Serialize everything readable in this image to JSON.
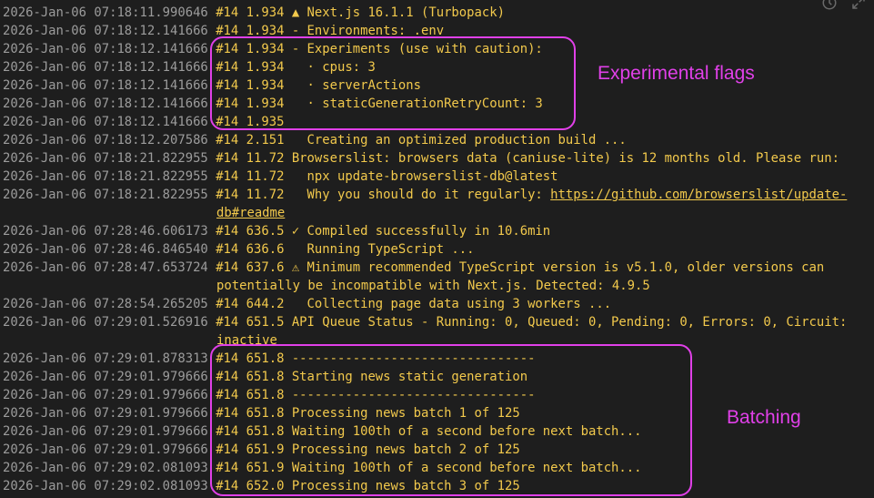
{
  "log_lines": [
    {
      "ts": "2026-Jan-06 07:18:11.990646",
      "msg": "#14 1.934 ▲ Next.js 16.1.1 (Turbopack)"
    },
    {
      "ts": "2026-Jan-06 07:18:12.141666",
      "msg": "#14 1.934 - Environments: .env"
    },
    {
      "ts": "2026-Jan-06 07:18:12.141666",
      "msg": "#14 1.934 - Experiments (use with caution):"
    },
    {
      "ts": "2026-Jan-06 07:18:12.141666",
      "msg": "#14 1.934   · cpus: 3"
    },
    {
      "ts": "2026-Jan-06 07:18:12.141666",
      "msg": "#14 1.934   · serverActions"
    },
    {
      "ts": "2026-Jan-06 07:18:12.141666",
      "msg": "#14 1.934   · staticGenerationRetryCount: 3"
    },
    {
      "ts": "2026-Jan-06 07:18:12.141666",
      "msg": "#14 1.935"
    },
    {
      "ts": "2026-Jan-06 07:18:12.207586",
      "msg": "#14 2.151   Creating an optimized production build ..."
    },
    {
      "ts": "2026-Jan-06 07:18:21.822955",
      "msg": "#14 11.72 Browserslist: browsers data (caniuse-lite) is 12 months old. Please run:"
    },
    {
      "ts": "2026-Jan-06 07:18:21.822955",
      "msg": "#14 11.72   npx update-browserslist-db@latest"
    },
    {
      "ts": "2026-Jan-06 07:18:21.822955",
      "msg": "#14 11.72   Why you should do it regularly: ",
      "link": "https://github.com/browserslist/update-"
    },
    {
      "ts": "",
      "msg": "",
      "link": "db#readme",
      "cont": true
    },
    {
      "ts": "2026-Jan-06 07:28:46.606173",
      "msg": "#14 636.5 ✓ Compiled successfully in 10.6min"
    },
    {
      "ts": "2026-Jan-06 07:28:46.846540",
      "msg": "#14 636.6   Running TypeScript ..."
    },
    {
      "ts": "2026-Jan-06 07:28:47.653724",
      "msg": "#14 637.6 ⚠ Minimum recommended TypeScript version is v5.1.0, older versions can"
    },
    {
      "ts": "",
      "msg": "potentially be incompatible with Next.js. Detected: 4.9.5",
      "cont": true
    },
    {
      "ts": "2026-Jan-06 07:28:54.265205",
      "msg": "#14 644.2   Collecting page data using 3 workers ..."
    },
    {
      "ts": "2026-Jan-06 07:29:01.526916",
      "msg": "#14 651.5 API Queue Status - Running: 0, Queued: 0, Pending: 0, Errors: 0, Circuit:"
    },
    {
      "ts": "",
      "msg": "inactive",
      "cont": true
    },
    {
      "ts": "2026-Jan-06 07:29:01.878313",
      "msg": "#14 651.8 --------------------------------"
    },
    {
      "ts": "2026-Jan-06 07:29:01.979666",
      "msg": "#14 651.8 Starting news static generation"
    },
    {
      "ts": "2026-Jan-06 07:29:01.979666",
      "msg": "#14 651.8 --------------------------------"
    },
    {
      "ts": "2026-Jan-06 07:29:01.979666",
      "msg": "#14 651.8 Processing news batch 1 of 125"
    },
    {
      "ts": "2026-Jan-06 07:29:01.979666",
      "msg": "#14 651.8 Waiting 100th of a second before next batch..."
    },
    {
      "ts": "2026-Jan-06 07:29:01.979666",
      "msg": "#14 651.9 Processing news batch 2 of 125"
    },
    {
      "ts": "2026-Jan-06 07:29:02.081093",
      "msg": "#14 651.9 Waiting 100th of a second before next batch..."
    },
    {
      "ts": "2026-Jan-06 07:29:02.081093",
      "msg": "#14 652.0 Processing news batch 3 of 125"
    }
  ],
  "annotations": {
    "experimental_label": "Experimental flags",
    "batching_label": "Batching"
  },
  "icons": [
    "clock-icon",
    "expand-icon"
  ],
  "colors": {
    "background": "#1e1e1e",
    "timestamp": "#9c9c9c",
    "message": "#f2c94c",
    "annotation": "#e040e8"
  }
}
